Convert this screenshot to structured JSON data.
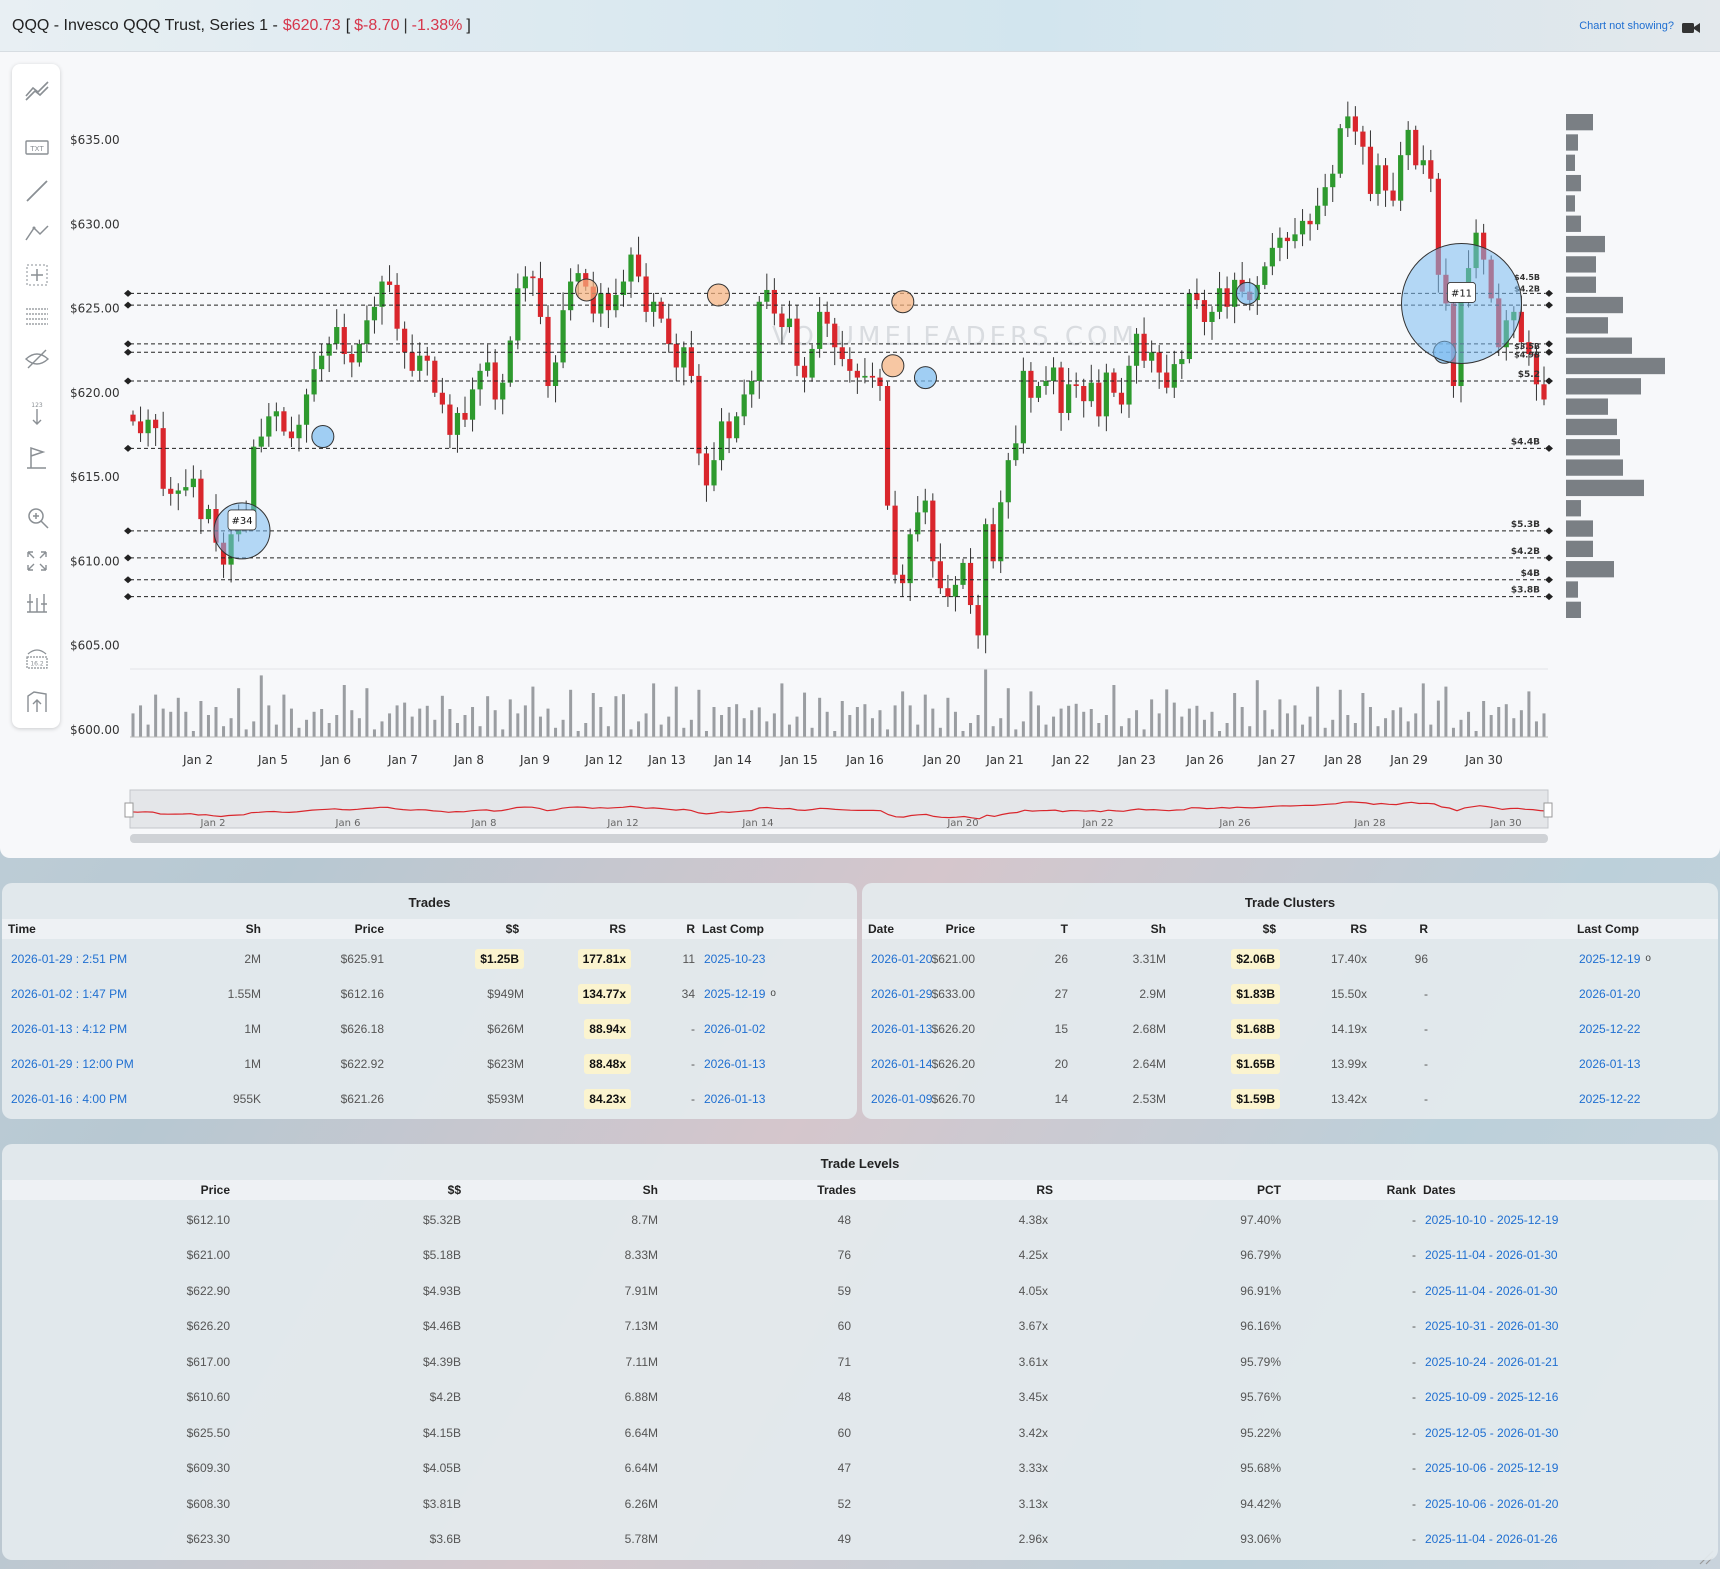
{
  "header": {
    "symbol_title": "QQQ - Invesco QQQ Trust, Series 1 -",
    "price": "$620.73",
    "change": "$-8.70",
    "change_pct": "-1.38%",
    "bracket_open": "[",
    "bracket_sep": "|",
    "bracket_close": "]",
    "help_link": "Chart not showing?",
    "camera_icon": "camera-icon"
  },
  "toolbar": {
    "icons": [
      "trend-lines-icon",
      "text-icon",
      "line-icon",
      "pattern-icon",
      "crosshair-icon",
      "fib-lines-icon",
      "hide-icon",
      "counter-icon",
      "flag-icon",
      "zoom-icon",
      "fullscreen-icon",
      "measure-icon",
      "visibility-icon",
      "save-icon"
    ],
    "text_icon_label": "TXT",
    "counter_label": "123",
    "visibility_label": "16.2"
  },
  "chart_data": {
    "type": "candlestick",
    "watermark": "VOLUMELEADERS.COM",
    "y_ticks": [
      "$635.00",
      "$630.00",
      "$625.00",
      "$620.00",
      "$615.00",
      "$610.00",
      "$605.00",
      "$600.00"
    ],
    "y_values": [
      635,
      630,
      625,
      620,
      615,
      610,
      605,
      600
    ],
    "ylim": [
      600,
      637
    ],
    "x_ticks": [
      "Jan 2",
      "Jan 5",
      "Jan 6",
      "Jan 7",
      "Jan 8",
      "Jan 9",
      "Jan 12",
      "Jan 13",
      "Jan 14",
      "Jan 15",
      "Jan 16",
      "Jan 20",
      "Jan 21",
      "Jan 22",
      "Jan 23",
      "Jan 26",
      "Jan 27",
      "Jan 28",
      "Jan 29",
      "Jan 30"
    ],
    "navigator_ticks": [
      "Jan 2",
      "Jan 6",
      "Jan 8",
      "Jan 12",
      "Jan 14",
      "Jan 20",
      "Jan 22",
      "Jan 26",
      "Jan 28",
      "Jan 30"
    ],
    "levels": [
      {
        "price": 625.9,
        "label": ""
      },
      {
        "price": 625.2,
        "label": ""
      },
      {
        "price": 622.9,
        "label": ""
      },
      {
        "price": 622.4,
        "label": ""
      },
      {
        "price": 620.7,
        "label": "$5.2"
      },
      {
        "price": 616.7,
        "label": "$4.4B"
      },
      {
        "price": 611.8,
        "label": "$5.3B"
      },
      {
        "price": 610.2,
        "label": "$4.2B"
      },
      {
        "price": 608.9,
        "label": "$4B"
      },
      {
        "price": 607.9,
        "label": "$3.8B"
      }
    ],
    "right_labels": [
      "$4.5B",
      "$4.2B",
      "$3.5B",
      "$4.9B"
    ],
    "cluster_markers": [
      {
        "label": "#34",
        "x_frac": 0.079,
        "price": 611.8,
        "size": "large"
      },
      {
        "label": "#11",
        "x_frac": 0.939,
        "price": 625.3,
        "size": "xlarge"
      }
    ],
    "trade_markers": [
      {
        "x_frac": 0.136,
        "price": 617.4,
        "kind": "blue"
      },
      {
        "x_frac": 0.322,
        "price": 626.1,
        "kind": "orange"
      },
      {
        "x_frac": 0.415,
        "price": 625.8,
        "kind": "orange"
      },
      {
        "x_frac": 0.545,
        "price": 625.4,
        "kind": "orange"
      },
      {
        "x_frac": 0.538,
        "price": 621.6,
        "kind": "orange"
      },
      {
        "x_frac": 0.561,
        "price": 620.9,
        "kind": "blue"
      },
      {
        "x_frac": 0.788,
        "price": 625.9,
        "kind": "blue"
      },
      {
        "x_frac": 0.927,
        "price": 622.4,
        "kind": "blue"
      }
    ],
    "volume_profile": [
      9,
      4,
      3,
      5,
      3,
      5,
      13,
      10,
      10,
      19,
      14,
      22,
      33,
      25,
      14,
      17,
      18,
      19,
      26,
      5,
      9,
      9,
      16,
      4,
      5
    ]
  },
  "trades": {
    "title": "Trades",
    "columns": [
      "Time",
      "Sh",
      "Price",
      "$$",
      "RS",
      "R",
      "Last Comp"
    ],
    "rows": [
      {
        "time": "2026-01-29 : 2:51 PM",
        "sh": "2M",
        "price": "$625.91",
        "dollars": "$1.25B",
        "rs": "177.81x",
        "r": "11",
        "last": "2025-10-23",
        "dot": ""
      },
      {
        "time": "2026-01-02 : 1:47 PM",
        "sh": "1.55M",
        "price": "$612.16",
        "dollars": "$949M",
        "rs": "134.77x",
        "r": "34",
        "last": "2025-12-19",
        "dot": "o"
      },
      {
        "time": "2026-01-13 : 4:12 PM",
        "sh": "1M",
        "price": "$626.18",
        "dollars": "$626M",
        "rs": "88.94x",
        "r": "-",
        "last": "2026-01-02",
        "dot": ""
      },
      {
        "time": "2026-01-29 : 12:00 PM",
        "sh": "1M",
        "price": "$622.92",
        "dollars": "$623M",
        "rs": "88.48x",
        "r": "-",
        "last": "2026-01-13",
        "dot": ""
      },
      {
        "time": "2026-01-16 : 4:00 PM",
        "sh": "955K",
        "price": "$621.26",
        "dollars": "$593M",
        "rs": "84.23x",
        "r": "-",
        "last": "2026-01-13",
        "dot": ""
      }
    ]
  },
  "clusters": {
    "title": "Trade Clusters",
    "columns": [
      "Date",
      "Price",
      "T",
      "Sh",
      "$$",
      "RS",
      "R",
      "Last Comp"
    ],
    "rows": [
      {
        "date": "2026-01-20",
        "price": "$621.00",
        "t": "26",
        "sh": "3.31M",
        "dollars": "$2.06B",
        "rs": "17.40x",
        "r": "96",
        "last": "2025-12-19",
        "dot": "o"
      },
      {
        "date": "2026-01-29",
        "price": "$633.00",
        "t": "27",
        "sh": "2.9M",
        "dollars": "$1.83B",
        "rs": "15.50x",
        "r": "-",
        "last": "2026-01-20",
        "dot": ""
      },
      {
        "date": "2026-01-13",
        "price": "$626.20",
        "t": "15",
        "sh": "2.68M",
        "dollars": "$1.68B",
        "rs": "14.19x",
        "r": "-",
        "last": "2025-12-22",
        "dot": ""
      },
      {
        "date": "2026-01-14",
        "price": "$626.20",
        "t": "20",
        "sh": "2.64M",
        "dollars": "$1.65B",
        "rs": "13.99x",
        "r": "-",
        "last": "2026-01-13",
        "dot": ""
      },
      {
        "date": "2026-01-09",
        "price": "$626.70",
        "t": "14",
        "sh": "2.53M",
        "dollars": "$1.59B",
        "rs": "13.42x",
        "r": "-",
        "last": "2025-12-22",
        "dot": ""
      }
    ]
  },
  "levels": {
    "title": "Trade Levels",
    "columns": [
      "Price",
      "$$",
      "Sh",
      "Trades",
      "RS",
      "PCT",
      "Rank",
      "Dates"
    ],
    "rows": [
      {
        "price": "$612.10",
        "dollars": "$5.32B",
        "sh": "8.7M",
        "trades": "48",
        "rs": "4.38x",
        "pct": "97.40%",
        "rank": "-",
        "dates": "2025-10-10 - 2025-12-19"
      },
      {
        "price": "$621.00",
        "dollars": "$5.18B",
        "sh": "8.33M",
        "trades": "76",
        "rs": "4.25x",
        "pct": "96.79%",
        "rank": "-",
        "dates": "2025-11-04 - 2026-01-30"
      },
      {
        "price": "$622.90",
        "dollars": "$4.93B",
        "sh": "7.91M",
        "trades": "59",
        "rs": "4.05x",
        "pct": "96.91%",
        "rank": "-",
        "dates": "2025-11-04 - 2026-01-30"
      },
      {
        "price": "$626.20",
        "dollars": "$4.46B",
        "sh": "7.13M",
        "trades": "60",
        "rs": "3.67x",
        "pct": "96.16%",
        "rank": "-",
        "dates": "2025-10-31 - 2026-01-30"
      },
      {
        "price": "$617.00",
        "dollars": "$4.39B",
        "sh": "7.11M",
        "trades": "71",
        "rs": "3.61x",
        "pct": "95.79%",
        "rank": "-",
        "dates": "2025-10-24 - 2026-01-21"
      },
      {
        "price": "$610.60",
        "dollars": "$4.2B",
        "sh": "6.88M",
        "trades": "48",
        "rs": "3.45x",
        "pct": "95.76%",
        "rank": "-",
        "dates": "2025-10-09 - 2025-12-16"
      },
      {
        "price": "$625.50",
        "dollars": "$4.15B",
        "sh": "6.64M",
        "trades": "60",
        "rs": "3.42x",
        "pct": "95.22%",
        "rank": "-",
        "dates": "2025-12-05 - 2026-01-30"
      },
      {
        "price": "$609.30",
        "dollars": "$4.05B",
        "sh": "6.64M",
        "trades": "47",
        "rs": "3.33x",
        "pct": "95.68%",
        "rank": "-",
        "dates": "2025-10-06 - 2025-12-19"
      },
      {
        "price": "$608.30",
        "dollars": "$3.81B",
        "sh": "6.26M",
        "trades": "52",
        "rs": "3.13x",
        "pct": "94.42%",
        "rank": "-",
        "dates": "2025-10-06 - 2026-01-20"
      },
      {
        "price": "$623.30",
        "dollars": "$3.6B",
        "sh": "5.78M",
        "trades": "49",
        "rs": "2.96x",
        "pct": "93.06%",
        "rank": "-",
        "dates": "2025-11-04 - 2026-01-26"
      }
    ]
  },
  "colors": {
    "up": "#2e9a2e",
    "down": "#d9262c",
    "link": "#1f6fd1",
    "highlight": "#fbf4cf",
    "cluster_blue": "#7bbcf0",
    "trade_orange": "#f6b27e",
    "volume_bar": "#9a9da1",
    "profile_bar": "#7a7f84"
  }
}
